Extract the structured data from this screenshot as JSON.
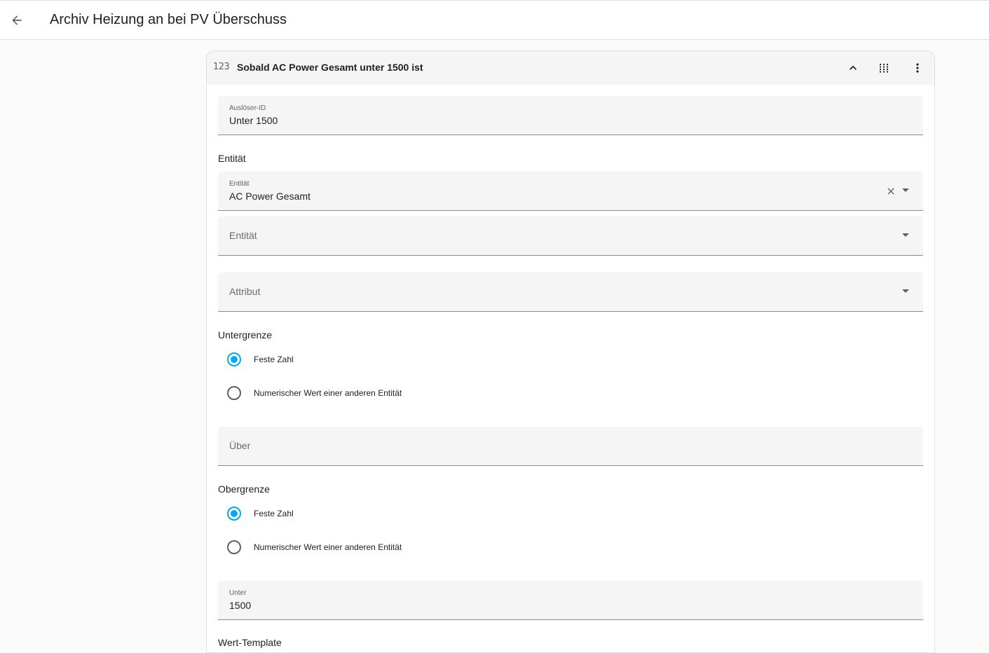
{
  "header": {
    "back_icon": "arrow-left-icon",
    "title": "Archiv Heizung an bei PV Überschuss"
  },
  "trigger": {
    "type_icon": "numeric-icon",
    "type_icon_text": "123",
    "title": "Sobald AC Power Gesamt unter 1500 ist",
    "actions": [
      "chevron-up-icon",
      "drag-handle-icon",
      "more-vertical-icon"
    ]
  },
  "form": {
    "trigger_id": {
      "label": "Auslöser-ID",
      "value": "Unter 1500"
    },
    "entity_section_label": "Entität",
    "entity_1": {
      "label": "Entität",
      "value": "AC Power Gesamt"
    },
    "entity_2": {
      "placeholder": "Entität"
    },
    "attribute": {
      "placeholder": "Attribut"
    },
    "lower_limit": {
      "section_label": "Untergrenze",
      "options": [
        "Feste Zahl",
        "Numerischer Wert einer anderen Entität"
      ],
      "selected": "Feste Zahl"
    },
    "above": {
      "placeholder": "Über"
    },
    "upper_limit": {
      "section_label": "Obergrenze",
      "options": [
        "Feste Zahl",
        "Numerischer Wert einer anderen Entität"
      ],
      "selected": "Feste Zahl"
    },
    "below": {
      "label": "Unter",
      "value": "1500"
    },
    "value_template_label": "Wert-Template"
  },
  "colors": {
    "accent": "#03a9f4",
    "field_bg": "#f5f5f5",
    "page_bg": "#fafafa"
  }
}
